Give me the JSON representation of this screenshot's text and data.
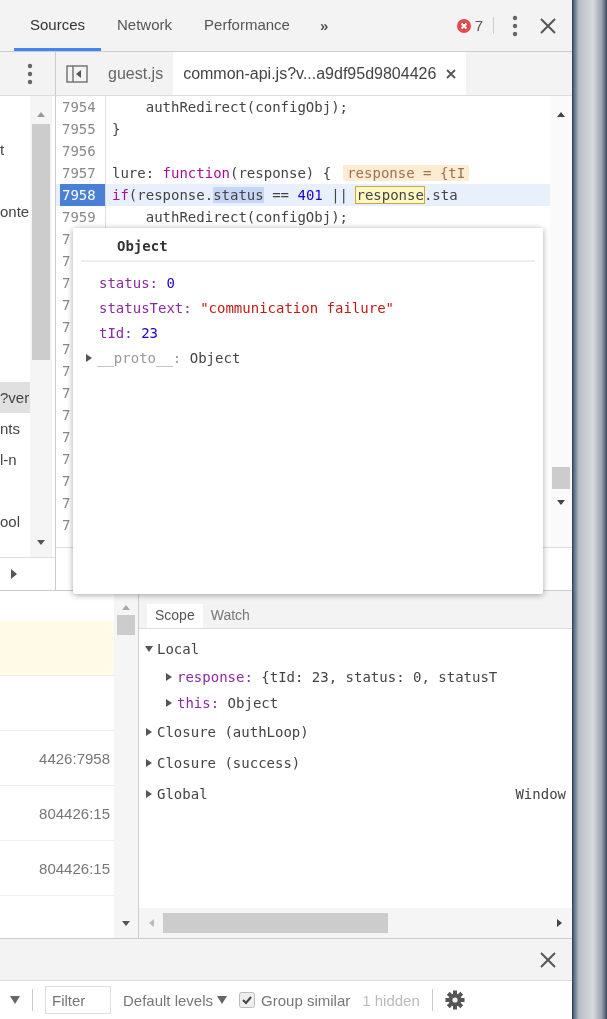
{
  "toolbar": {
    "tabs": [
      {
        "label": "Sources",
        "selected": true
      },
      {
        "label": "Network",
        "selected": false
      },
      {
        "label": "Performance",
        "selected": false
      }
    ],
    "more": "»",
    "error_count": "7"
  },
  "file_tabs": [
    {
      "label": "guest.js",
      "selected": false,
      "closable": false
    },
    {
      "label": "common-api.js?v...a9df95d9804426",
      "selected": true,
      "closable": true
    }
  ],
  "navigator": {
    "items": [
      {
        "text": "t",
        "selected": false
      },
      {
        "text": "onte",
        "selected": false
      },
      {
        "text": "?ver",
        "selected": true
      },
      {
        "text": "nts",
        "selected": false
      },
      {
        "text": "l-n",
        "selected": false
      },
      {
        "text": "ool",
        "selected": false
      }
    ]
  },
  "editor": {
    "lines": [
      {
        "number": "7954",
        "breakpoint": false,
        "tokens": [
          {
            "kind": "plain",
            "text": "    authRedirect(configObj);"
          }
        ]
      },
      {
        "number": "7955",
        "breakpoint": false,
        "tokens": [
          {
            "kind": "plain",
            "text": "}"
          }
        ]
      },
      {
        "number": "7956",
        "breakpoint": false
      },
      {
        "number": "7957",
        "breakpoint": false,
        "tokens": [
          {
            "kind": "plain",
            "text": "lure: "
          },
          {
            "kind": "keyword",
            "text": "function"
          },
          {
            "kind": "plain",
            "text": "(response) {"
          },
          {
            "kind": "inline",
            "text": "response = {tI"
          }
        ]
      },
      {
        "number": "7958",
        "breakpoint": true,
        "tokens": [
          {
            "kind": "keyword",
            "text": "if"
          },
          {
            "kind": "plain",
            "text": "(response."
          },
          {
            "kind": "selected",
            "text": "status"
          },
          {
            "kind": "plain",
            "text": " == "
          },
          {
            "kind": "number",
            "text": "401"
          },
          {
            "kind": "plain",
            "text": " || "
          },
          {
            "kind": "hover",
            "text": "response"
          },
          {
            "kind": "plain",
            "text": ".sta"
          }
        ]
      },
      {
        "number": "7959",
        "breakpoint": false,
        "tokens": [
          {
            "kind": "plain",
            "text": "    authRedirect(configObj);"
          }
        ]
      },
      {
        "number": "7",
        "breakpoint": false
      },
      {
        "number": "7",
        "breakpoint": false
      },
      {
        "number": "7",
        "breakpoint": false
      },
      {
        "number": "7",
        "breakpoint": false
      },
      {
        "number": "7",
        "breakpoint": false
      },
      {
        "number": "7",
        "breakpoint": false
      },
      {
        "number": "7",
        "breakpoint": false
      },
      {
        "number": "7",
        "breakpoint": false
      },
      {
        "number": "7",
        "breakpoint": false
      },
      {
        "number": "7",
        "breakpoint": false
      },
      {
        "number": "7",
        "breakpoint": false
      },
      {
        "number": "7",
        "breakpoint": false
      },
      {
        "number": "7",
        "breakpoint": false
      },
      {
        "number": "7",
        "breakpoint": false
      }
    ]
  },
  "popover": {
    "title": "Object",
    "properties": [
      {
        "key": "status:",
        "value": "0",
        "kind": "number"
      },
      {
        "key": "statusText:",
        "value": "\"communication failure\"",
        "kind": "string"
      },
      {
        "key": "tId:",
        "value": "23",
        "kind": "number"
      },
      {
        "key": "__proto__:",
        "value": "Object",
        "kind": "proto"
      }
    ]
  },
  "call_stack": {
    "rows": [
      {
        "selected": true
      },
      {
        "selected": false
      },
      {
        "location": "4426:7958",
        "selected": false
      },
      {
        "location": "804426:15",
        "selected": false
      },
      {
        "location": "804426:15",
        "selected": false
      }
    ]
  },
  "scope": {
    "tabs": [
      {
        "label": "Scope",
        "selected": true
      },
      {
        "label": "Watch",
        "selected": false
      }
    ],
    "tree": [
      {
        "label": "Local",
        "expanded": true,
        "children": [
          {
            "key": "response:",
            "value": "{tId: 23, status: 0, statusT",
            "expanded": false
          },
          {
            "key": "this:",
            "value": "Object",
            "expanded": false
          }
        ]
      },
      {
        "label": "Closure (authLoop)",
        "expanded": false
      },
      {
        "label": "Closure (success)",
        "expanded": false
      },
      {
        "label": "Global",
        "value": "Window",
        "expanded": false
      }
    ]
  },
  "console": {
    "filter": {
      "placeholder": "Filter"
    },
    "levels": "Default levels",
    "group_similar": {
      "label": "Group similar",
      "checked": true
    },
    "hidden": "1 hidden"
  }
}
